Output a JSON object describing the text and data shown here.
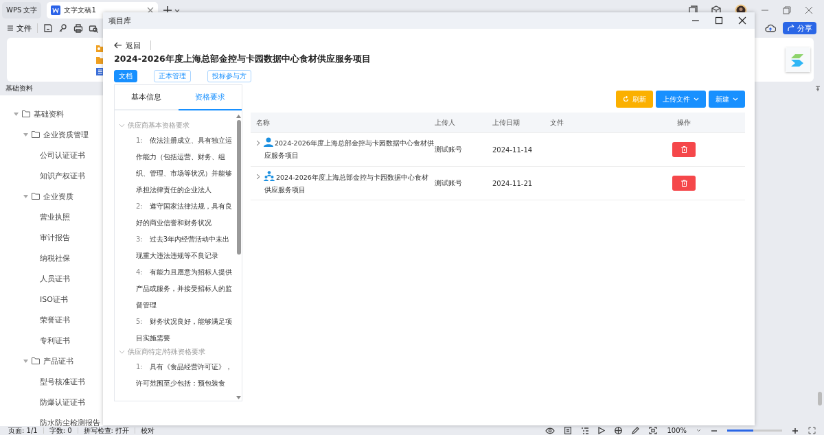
{
  "app_tabs": [
    {
      "label": "WPS 文字",
      "kind": "home",
      "selected": false
    },
    {
      "label": "文字文稿1",
      "kind": "doc",
      "selected": true
    }
  ],
  "toolbar": {
    "menu": "文件",
    "share": "分享"
  },
  "panel_label": "基础资料",
  "tree": [
    {
      "label": "基础资料",
      "expanded": true,
      "children": [
        {
          "label": "企业资质管理",
          "expanded": true,
          "children": [
            {
              "label": "公司认证证书"
            },
            {
              "label": "知识产权证书"
            }
          ]
        },
        {
          "label": "企业资质",
          "expanded": true,
          "children": [
            {
              "label": "营业执照"
            },
            {
              "label": "审计报告"
            },
            {
              "label": "纳税社保"
            },
            {
              "label": "人员证书"
            },
            {
              "label": "ISO证书"
            },
            {
              "label": "荣誉证书"
            },
            {
              "label": "专利证书"
            }
          ]
        },
        {
          "label": "产品证书",
          "expanded": true,
          "children": [
            {
              "label": "型号核准证书"
            },
            {
              "label": "防爆认证证书"
            },
            {
              "label": "防水防尘检测报告"
            }
          ]
        }
      ]
    }
  ],
  "status_bar": {
    "items": [
      "页面: 1/1",
      "字数: 0",
      "拼写检查: 打开",
      "校对"
    ],
    "zoom": "100%",
    "zoom_slider": {
      "level": 0.48
    }
  },
  "dialog": {
    "title": "项目库",
    "back": "返回",
    "project_title": "2024-2026年度上海总部金控与卡园数据中心食材供应服务项目",
    "sections": [
      {
        "label": "文档",
        "selected": true
      },
      {
        "label": "正本管理",
        "selected": false
      },
      {
        "label": "投标参与方",
        "selected": false
      }
    ],
    "tabs": [
      {
        "label": "基本信息",
        "selected": false
      },
      {
        "label": "资格要求",
        "selected": true
      }
    ],
    "requirements": [
      {
        "label": "供应商基本资格要求",
        "expanded": true,
        "items": [
          {
            "number": "1:",
            "text": "依法注册成立、具有独立运作能力（包括运营、财务、组织、管理、市场等状况）并能够承担法律责任的企业法人"
          },
          {
            "number": "2:",
            "text": "遵守国家法律法规，具有良好的商业信誉和财务状况"
          },
          {
            "number": "3:",
            "text": "过去3年内经营活动中未出现重大违法违规等不良记录"
          },
          {
            "number": "4:",
            "text": "有能力且愿意为招标人提供产品或服务，并接受招标人的监督管理"
          },
          {
            "number": "5:",
            "text": "财务状况良好，能够满足项目实施需要"
          }
        ]
      },
      {
        "label": "供应商特定/特殊资格要求",
        "expanded": true,
        "items": [
          {
            "number": "1:",
            "text": "具有《食品经营许可证》，许可范围至少包括：预包装食"
          }
        ]
      }
    ],
    "actions": [
      {
        "label": "刷新",
        "kind": "refresh"
      },
      {
        "label": "上传文件",
        "kind": "dropdown"
      },
      {
        "label": "新建",
        "kind": "dropdown"
      }
    ],
    "table": {
      "columns": [
        "名称",
        "上传人",
        "上传日期",
        "文件",
        "操作"
      ],
      "rows": [
        {
          "kind": "person",
          "expanded": false,
          "name": "2024-2026年度上海总部金控与卡园数据中心食材供应服务项目",
          "uploader": "测试账号",
          "date": "2024-11-14"
        },
        {
          "kind": "group",
          "expanded": false,
          "name": "2024-2026年度上海总部金控与卡园数据中心食材供应服务项目",
          "uploader": "测试账号",
          "date": "2024-11-21"
        }
      ]
    }
  }
}
